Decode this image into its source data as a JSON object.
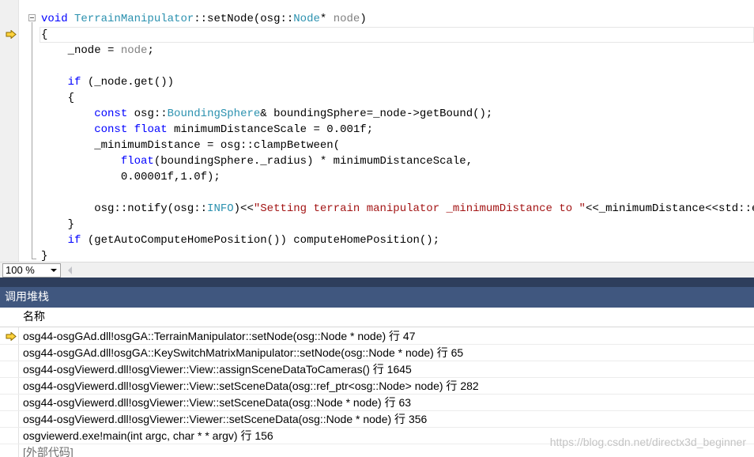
{
  "editor": {
    "lines": [
      [
        {
          "t": "void",
          "c": "kw"
        },
        {
          "t": " "
        },
        {
          "t": "TerrainManipulator",
          "c": "ty"
        },
        {
          "t": "::setNode(osg::"
        },
        {
          "t": "Node",
          "c": "ty"
        },
        {
          "t": "* "
        },
        {
          "t": "node",
          "c": "par"
        },
        {
          "t": ")"
        }
      ],
      [
        {
          "t": "{"
        }
      ],
      [
        {
          "t": "    _node = "
        },
        {
          "t": "node",
          "c": "par"
        },
        {
          "t": ";"
        }
      ],
      [
        {
          "t": ""
        }
      ],
      [
        {
          "t": "    "
        },
        {
          "t": "if",
          "c": "kw"
        },
        {
          "t": " (_node.get())"
        }
      ],
      [
        {
          "t": "    {"
        }
      ],
      [
        {
          "t": "        "
        },
        {
          "t": "const",
          "c": "kw"
        },
        {
          "t": " osg::"
        },
        {
          "t": "BoundingSphere",
          "c": "ty"
        },
        {
          "t": "& boundingSphere=_node->getBound();"
        }
      ],
      [
        {
          "t": "        "
        },
        {
          "t": "const",
          "c": "kw"
        },
        {
          "t": " "
        },
        {
          "t": "float",
          "c": "kw"
        },
        {
          "t": " minimumDistanceScale = 0.001f;"
        }
      ],
      [
        {
          "t": "        _minimumDistance = osg::clampBetween("
        }
      ],
      [
        {
          "t": "            "
        },
        {
          "t": "float",
          "c": "kw"
        },
        {
          "t": "(boundingSphere._radius) * minimumDistanceScale,"
        }
      ],
      [
        {
          "t": "            0.00001f,1.0f);"
        }
      ],
      [
        {
          "t": ""
        }
      ],
      [
        {
          "t": "        osg::notify(osg::"
        },
        {
          "t": "INFO",
          "c": "ty"
        },
        {
          "t": ")<<"
        },
        {
          "t": "\"Setting terrain manipulator _minimumDistance to \"",
          "c": "str"
        },
        {
          "t": "<<_minimumDistance<<std::endl;"
        }
      ],
      [
        {
          "t": "    }"
        }
      ],
      [
        {
          "t": "    "
        },
        {
          "t": "if",
          "c": "kw"
        },
        {
          "t": " (getAutoComputeHomePosition()) computeHomePosition();"
        }
      ],
      [
        {
          "t": "}"
        }
      ]
    ],
    "current_line_index": 1,
    "zoom": "100 %"
  },
  "callstack": {
    "title": "调用堆栈",
    "column_header": "名称",
    "current_frame_index": 0,
    "frames": [
      "osg44-osgGAd.dll!osgGA::TerrainManipulator::setNode(osg::Node * node) 行 47",
      "osg44-osgGAd.dll!osgGA::KeySwitchMatrixManipulator::setNode(osg::Node * node) 行 65",
      "osg44-osgViewerd.dll!osgViewer::View::assignSceneDataToCameras() 行 1645",
      "osg44-osgViewerd.dll!osgViewer::View::setSceneData(osg::ref_ptr<osg::Node> node) 行 282",
      "osg44-osgViewerd.dll!osgViewer::View::setSceneData(osg::Node * node) 行 63",
      "osg44-osgViewerd.dll!osgViewer::Viewer::setSceneData(osg::Node * node) 行 356",
      "osgviewerd.exe!main(int argc, char * * argv) 行 156",
      "[外部代码]"
    ]
  },
  "watermark": "https://blog.csdn.net/directx3d_beginner",
  "colors": {
    "keyword": "#0000ff",
    "type": "#2b91af",
    "string": "#a31515",
    "parameter": "#808080",
    "panel_title_bg": "#40577f",
    "arrow_fill": "#ffd33d"
  },
  "icons": {
    "instruction_pointer": "current-statement-arrow-icon",
    "frame_pointer": "current-frame-arrow-icon"
  }
}
